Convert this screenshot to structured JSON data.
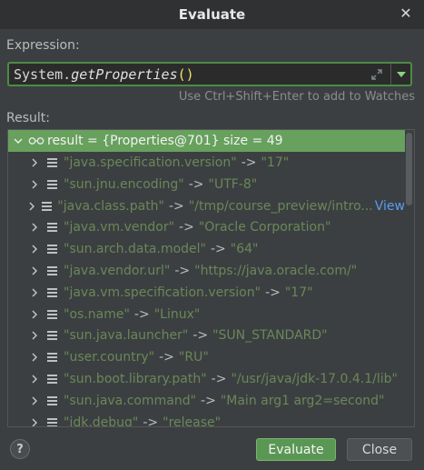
{
  "window": {
    "title": "Evaluate"
  },
  "expression": {
    "label": "Expression:",
    "prefix": "System.",
    "method": "getProperties",
    "parens": "()",
    "hint": "Use Ctrl+Shift+Enter to add to Watches"
  },
  "result": {
    "label": "Result:",
    "root": "result = {Properties@701}  size = 49",
    "entries": [
      {
        "key": "\"java.specification.version\"",
        "value": "\"17\""
      },
      {
        "key": "\"sun.jnu.encoding\"",
        "value": "\"UTF-8\""
      },
      {
        "key": "\"java.class.path\"",
        "value": "\"/tmp/course_preview/intro...",
        "link": "View"
      },
      {
        "key": "\"java.vm.vendor\"",
        "value": "\"Oracle Corporation\""
      },
      {
        "key": "\"sun.arch.data.model\"",
        "value": "\"64\""
      },
      {
        "key": "\"java.vendor.url\"",
        "value": "\"https://java.oracle.com/\""
      },
      {
        "key": "\"java.vm.specification.version\"",
        "value": "\"17\""
      },
      {
        "key": "\"os.name\"",
        "value": "\"Linux\""
      },
      {
        "key": "\"sun.java.launcher\"",
        "value": "\"SUN_STANDARD\""
      },
      {
        "key": "\"user.country\"",
        "value": "\"RU\""
      },
      {
        "key": "\"sun.boot.library.path\"",
        "value": "\"/usr/java/jdk-17.0.4.1/lib\""
      },
      {
        "key": "\"sun.java.command\"",
        "value": "\"Main arg1 arg2=second\""
      },
      {
        "key": "\"jdk.debug\"",
        "value": "\"release\""
      }
    ],
    "arrow": "->"
  },
  "buttons": {
    "evaluate": "Evaluate",
    "close": "Close",
    "help": "?"
  },
  "colors": {
    "accent": "#67a15d",
    "string_value": "#6a8759",
    "link": "#589df6",
    "background": "#3c3f41"
  },
  "icons": {
    "close": "close-icon",
    "expand": "expand-icon",
    "dropdown": "dropdown-arrow-icon",
    "watch": "glasses-icon",
    "entry": "list-entry-icon",
    "help": "help-icon"
  }
}
